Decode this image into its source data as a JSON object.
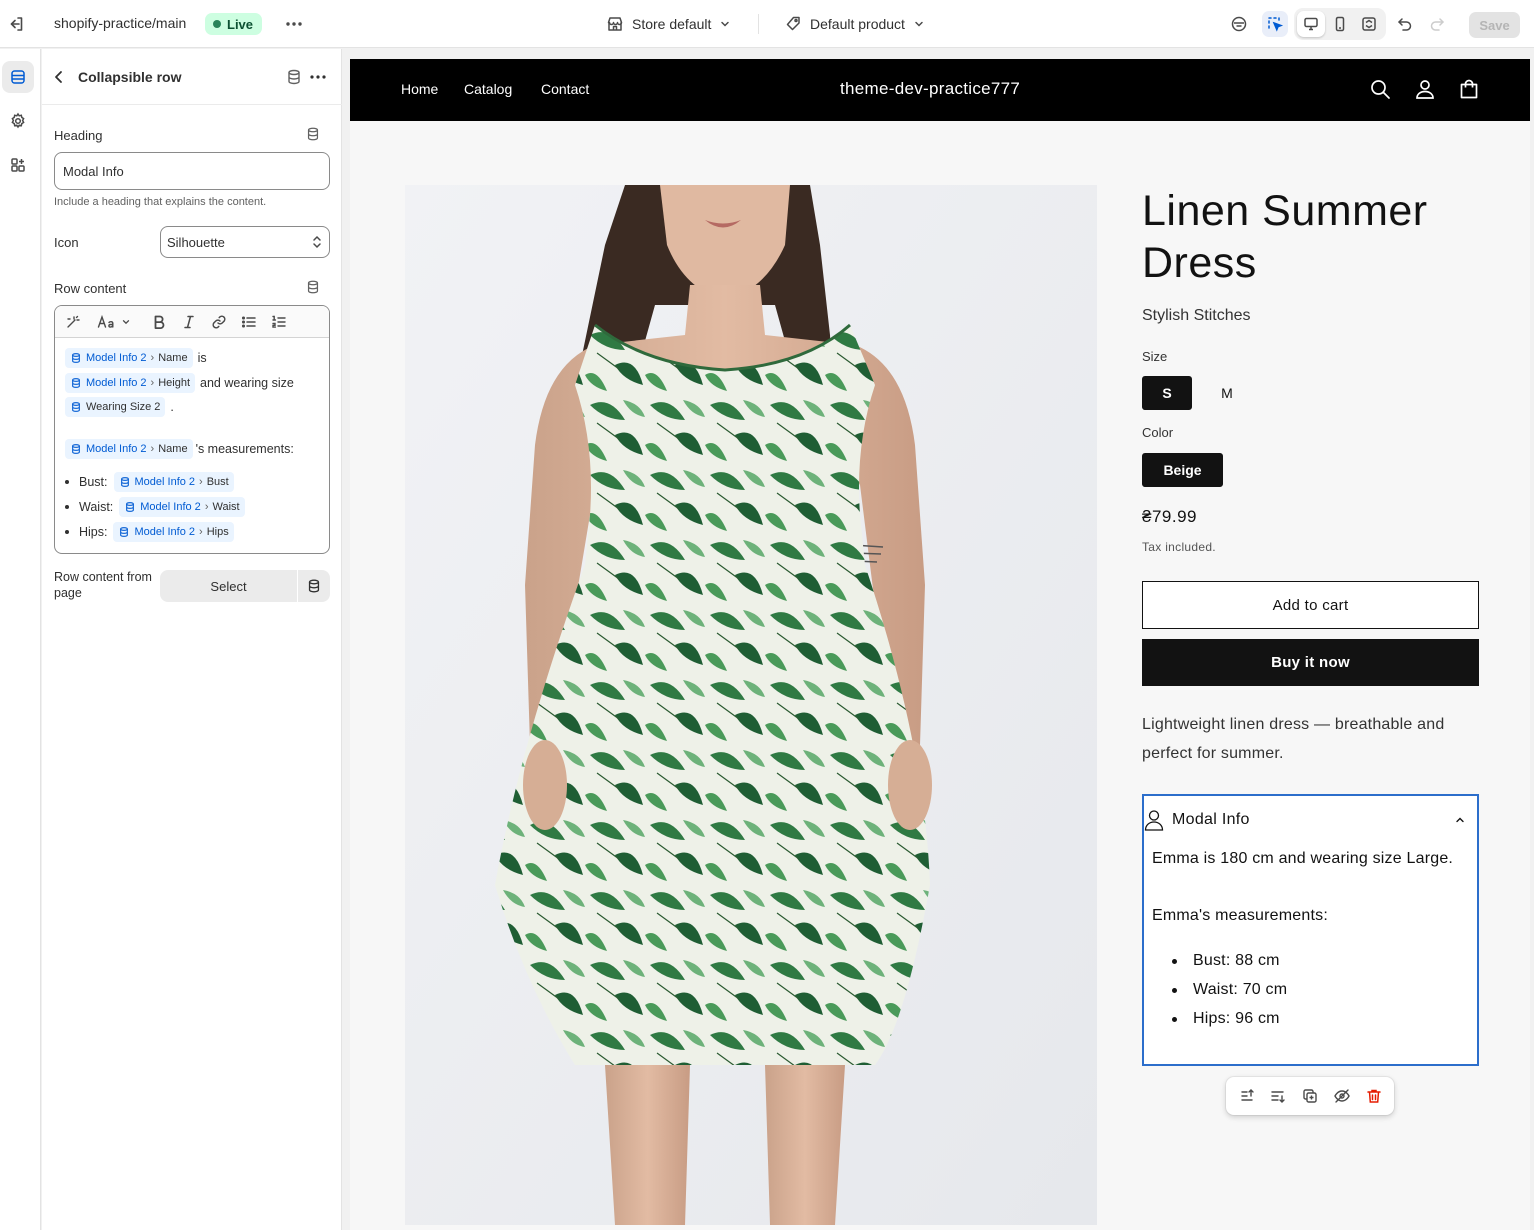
{
  "topbar": {
    "theme_name": "shopify-practice/main",
    "live_badge": "Live",
    "store_select": "Store default",
    "product_select": "Default product",
    "save_label": "Save"
  },
  "panel": {
    "title": "Collapsible row",
    "heading_label": "Heading",
    "heading_value": "Modal Info",
    "heading_help": "Include a heading that explains the content.",
    "icon_label": "Icon",
    "icon_value": "Silhouette",
    "row_content_label": "Row content",
    "rte": {
      "line1_source": "Model Info 2",
      "line1_field": "Name",
      "line1_text": "is",
      "line2_source": "Model Info 2",
      "line2_field": "Height",
      "line2_text": "and wearing size",
      "line3_field": "Wearing Size 2",
      "line3_text": ".",
      "line4_source": "Model Info 2",
      "line4_field": "Name",
      "line4_text": "'s measurements:",
      "bullets": [
        {
          "label": "Bust:",
          "source": "Model Info 2",
          "field": "Bust"
        },
        {
          "label": "Waist:",
          "source": "Model Info 2",
          "field": "Waist"
        },
        {
          "label": "Hips:",
          "source": "Model Info 2",
          "field": "Hips"
        }
      ]
    },
    "row_content_page_label": "Row content from page",
    "select_label": "Select"
  },
  "store": {
    "nav": [
      "Home",
      "Catalog",
      "Contact"
    ],
    "name": "theme-dev-practice777"
  },
  "product": {
    "title": "Linen Summer Dress",
    "vendor": "Stylish Stitches",
    "size_label": "Size",
    "sizes": [
      "S",
      "M"
    ],
    "selected_size": "S",
    "color_label": "Color",
    "colors": [
      "Beige"
    ],
    "selected_color": "Beige",
    "price": "₴79.99",
    "tax_note": "Tax included.",
    "add_to_cart": "Add to cart",
    "buy_now": "Buy it now",
    "description": "Lightweight linen dress — breathable and perfect for summer.",
    "collapsible": {
      "title": "Modal Info",
      "line1": "Emma is 180 cm and wearing size Large.",
      "line2": "Emma's measurements:",
      "items": [
        "Bust: 88 cm",
        "Waist: 70 cm",
        "Hips: 96 cm"
      ]
    }
  },
  "colors": {
    "accent": "#005bd3",
    "selection_outline": "#2c6ecb",
    "live_badge_bg": "#cdfee1",
    "store_header_bg": "#000000",
    "button_dark": "#121212",
    "danger": "#e51c00"
  }
}
